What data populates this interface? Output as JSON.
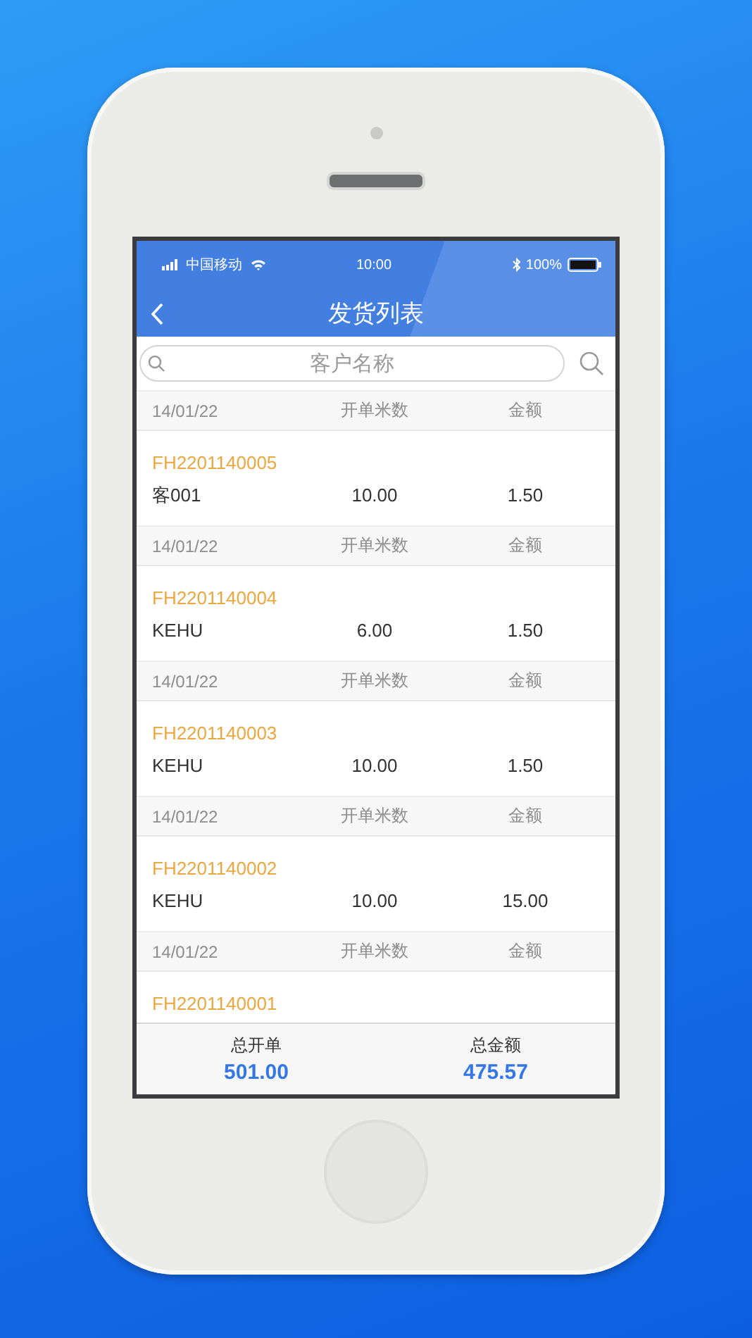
{
  "status_bar": {
    "carrier": "中国移动",
    "time": "10:00",
    "battery": "100%"
  },
  "nav": {
    "title": "发货列表"
  },
  "search": {
    "placeholder": "客户名称"
  },
  "orders": [
    {
      "date": "14/01/22",
      "col2_label": "开单米数",
      "col3_label": "金额",
      "number": "FH2201140005",
      "customer": "客001",
      "meters": "10.00",
      "amount": "1.50"
    },
    {
      "date": "14/01/22",
      "col2_label": "开单米数",
      "col3_label": "金额",
      "number": "FH2201140004",
      "customer": "KEHU",
      "meters": "6.00",
      "amount": "1.50"
    },
    {
      "date": "14/01/22",
      "col2_label": "开单米数",
      "col3_label": "金额",
      "number": "FH2201140003",
      "customer": "KEHU",
      "meters": "10.00",
      "amount": "1.50"
    },
    {
      "date": "14/01/22",
      "col2_label": "开单米数",
      "col3_label": "金额",
      "number": "FH2201140002",
      "customer": "KEHU",
      "meters": "10.00",
      "amount": "15.00"
    },
    {
      "date": "14/01/22",
      "col2_label": "开单米数",
      "col3_label": "金额",
      "number": "FH2201140001"
    }
  ],
  "totals": [
    {
      "label": "总开单",
      "value": "501.00"
    },
    {
      "label": "总金额",
      "value": "475.57"
    }
  ]
}
